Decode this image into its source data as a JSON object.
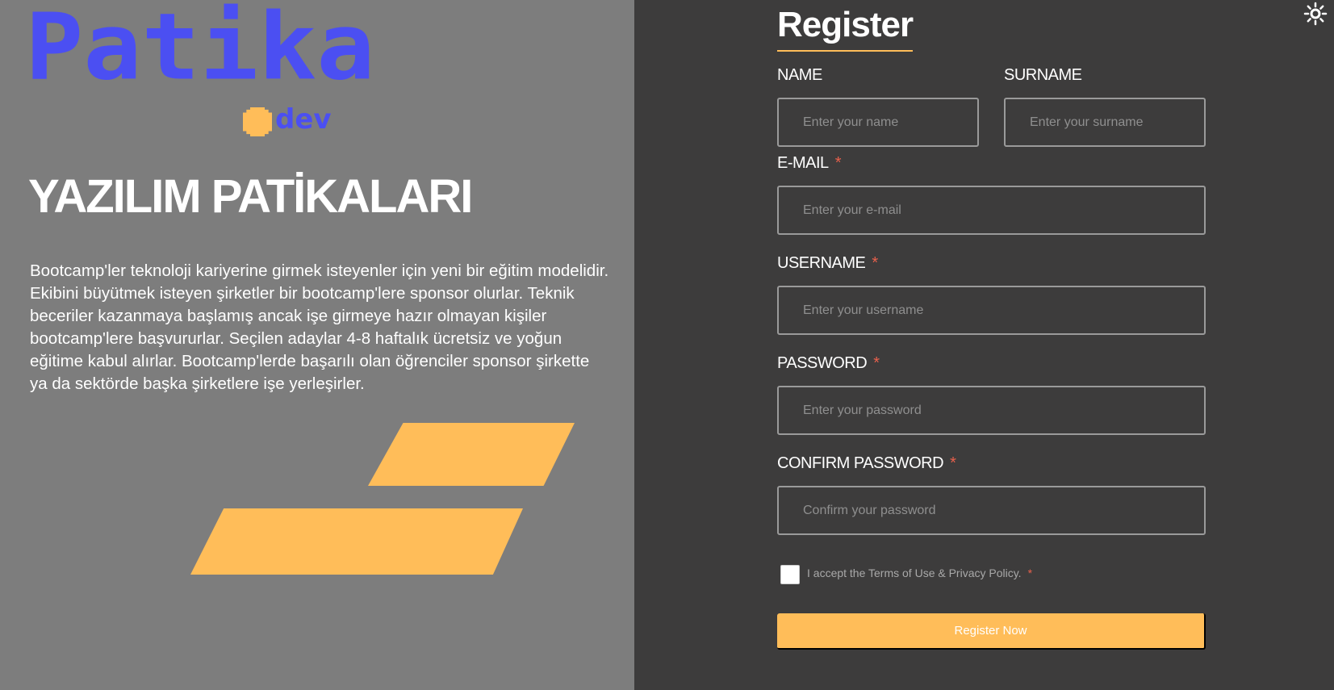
{
  "logo": {
    "word": "Patika",
    "sub": "dev"
  },
  "hero": {
    "headline": "YAZILIM PATİKALARI",
    "description": "Bootcamp'ler teknoloji kariyerine girmek isteyenler için yeni bir eğitim modelidir. Ekibini büyütmek isteyen şirketler bir bootcamp'lere sponsor olurlar. Teknik beceriler kazanmaya başlamış ancak işe girmeye hazır olmayan kişiler bootcamp'lere başvururlar. Seçilen adaylar 4-8 haftalık ücretsiz ve yoğun eğitime kabul alırlar. Bootcamp'lerde başarılı olan öğrenciler sponsor şirkette ya da sektörde başka şirketlere işe yerleşirler."
  },
  "form": {
    "title": "Register",
    "name": {
      "label": "NAME",
      "placeholder": "Enter your name"
    },
    "surname": {
      "label": "SURNAME",
      "placeholder": "Enter your surname"
    },
    "email": {
      "label": "E-MAIL",
      "required": "*",
      "placeholder": "Enter your e-mail"
    },
    "username": {
      "label": "USERNAME",
      "required": "*",
      "placeholder": "Enter your username"
    },
    "password": {
      "label": "PASSWORD",
      "required": "*",
      "placeholder": "Enter your password"
    },
    "confirm": {
      "label": "CONFIRM PASSWORD",
      "required": "*",
      "placeholder": "Confirm your password"
    },
    "terms": {
      "text": "I accept the Terms of Use & Privacy Policy.",
      "required": "*",
      "checked": false
    },
    "submit_label": "Register Now"
  },
  "colors": {
    "accent": "#ffbd59",
    "brand": "#4b4ff2",
    "required": "#e8604c",
    "left_bg": "#7d7d7d",
    "right_bg": "#3d3c3c"
  },
  "icons": {
    "theme_toggle": "sun-icon"
  }
}
